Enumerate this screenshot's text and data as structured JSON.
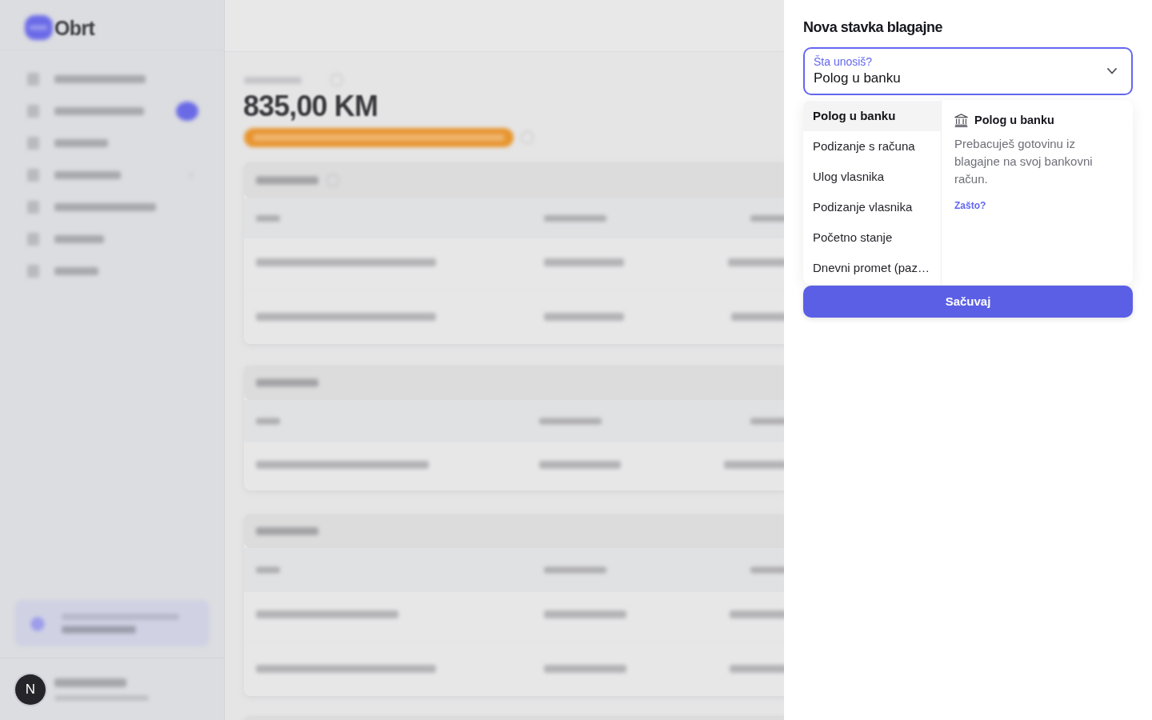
{
  "backdrop": {
    "logo": "Obrt",
    "balance": "835,00 KM",
    "avatar_initial": "N"
  },
  "panel": {
    "title": "Nova stavka blagajne",
    "field": {
      "label": "Šta unosiš?",
      "value": "Polog u banku",
      "expanded": true
    },
    "options": [
      {
        "label": "Polog u banku",
        "selected": true
      },
      {
        "label": "Podizanje s računa",
        "selected": false
      },
      {
        "label": "Ulog vlasnika",
        "selected": false
      },
      {
        "label": "Podizanje vlasnika",
        "selected": false
      },
      {
        "label": "Početno stanje",
        "selected": false
      },
      {
        "label": "Dnevni promet (paz…",
        "selected": false
      }
    ],
    "detail": {
      "title": "Polog u banku",
      "description": "Prebacuješ gotovinu iz blagajne na svoj bankovni račun.",
      "link": "Zašto?"
    },
    "save_button": "Sačuvaj"
  }
}
